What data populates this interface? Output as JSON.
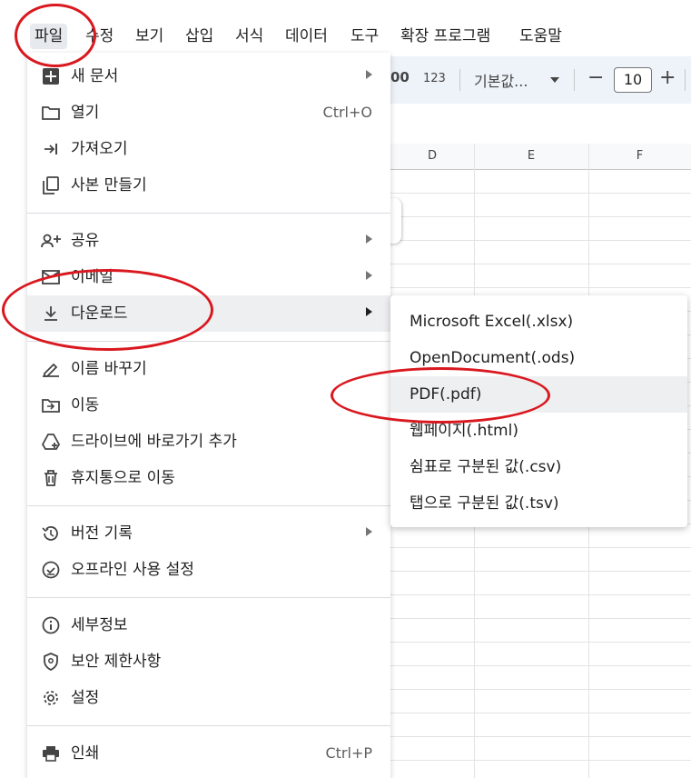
{
  "menubar": {
    "items": [
      "파일",
      "수정",
      "보기",
      "삽입",
      "서식",
      "데이터",
      "도구",
      "확장 프로그램",
      "도움말"
    ]
  },
  "toolbar": {
    "decimal_label": "00",
    "format_123": "123",
    "font_label": "기본값...",
    "minus": "−",
    "font_size": "10",
    "plus": "+"
  },
  "grid": {
    "columns": [
      "D",
      "E",
      "F"
    ]
  },
  "file_menu": {
    "items": [
      {
        "label": "새 문서",
        "icon": "new-document-icon",
        "submenu": true
      },
      {
        "label": "열기",
        "icon": "folder-icon",
        "shortcut": "Ctrl+O"
      },
      {
        "label": "가져오기",
        "icon": "import-icon"
      },
      {
        "label": "사본 만들기",
        "icon": "copy-icon"
      },
      {
        "label": "공유",
        "icon": "share-icon",
        "submenu": true
      },
      {
        "label": "이메일",
        "icon": "email-icon",
        "submenu": true
      },
      {
        "label": "다운로드",
        "icon": "download-icon",
        "submenu": true
      },
      {
        "label": "이름 바꾸기",
        "icon": "rename-icon"
      },
      {
        "label": "이동",
        "icon": "move-folder-icon"
      },
      {
        "label": "드라이브에 바로가기 추가",
        "icon": "drive-shortcut-icon"
      },
      {
        "label": "휴지통으로 이동",
        "icon": "trash-icon"
      },
      {
        "label": "버전 기록",
        "icon": "history-icon",
        "submenu": true
      },
      {
        "label": "오프라인 사용 설정",
        "icon": "offline-icon"
      },
      {
        "label": "세부정보",
        "icon": "info-icon"
      },
      {
        "label": "보안 제한사항",
        "icon": "security-icon"
      },
      {
        "label": "설정",
        "icon": "gear-icon"
      },
      {
        "label": "인쇄",
        "icon": "print-icon",
        "shortcut": "Ctrl+P"
      }
    ]
  },
  "download_submenu": {
    "items": [
      "Microsoft Excel(.xlsx)",
      "OpenDocument(.ods)",
      "PDF(.pdf)",
      "웹페이지(.html)",
      "쉼표로 구분된 값(.csv)",
      "탭으로 구분된 값(.tsv)"
    ]
  }
}
